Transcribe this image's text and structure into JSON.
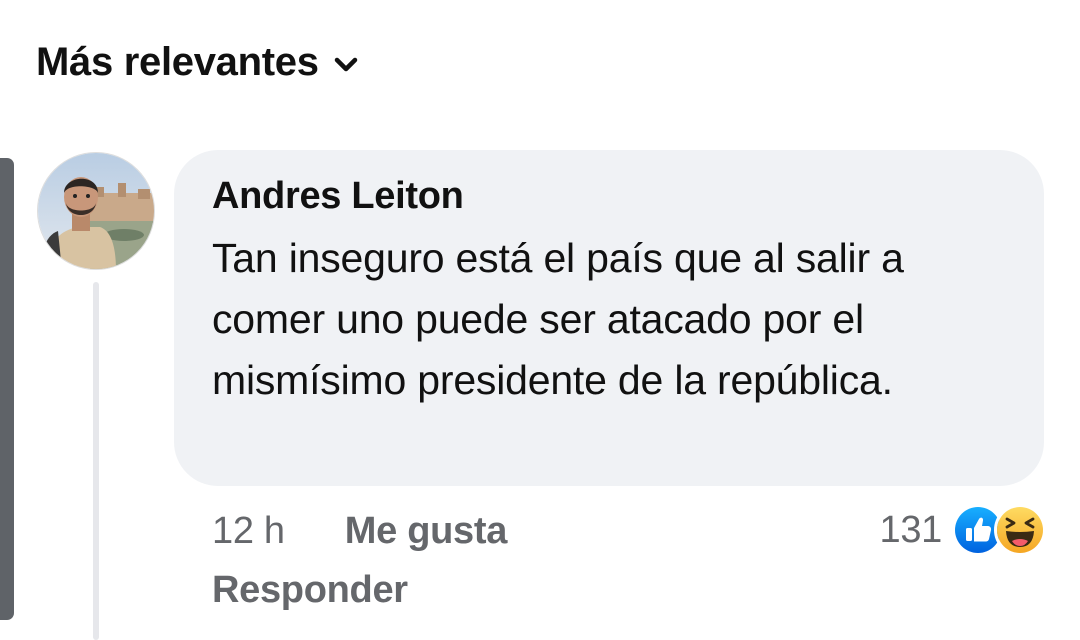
{
  "sort": {
    "label": "Más relevantes",
    "icon": "chevron-down-icon"
  },
  "comment": {
    "author": "Andres Leiton",
    "text": "Tan inseguro está el país que al salir a comer uno puede ser atacado por el mismísimo presidente de la república.",
    "time": "12 h",
    "like_label": "Me gusta",
    "reply_label": "Responder",
    "reaction_count": "131",
    "reactions": [
      "like-icon",
      "haha-icon"
    ]
  },
  "colors": {
    "bubble": "#f0f2f5",
    "text_primary": "#111111",
    "text_secondary": "#65676b",
    "like_blue": "#1877f2",
    "haha_yellow": "#f7b928"
  }
}
